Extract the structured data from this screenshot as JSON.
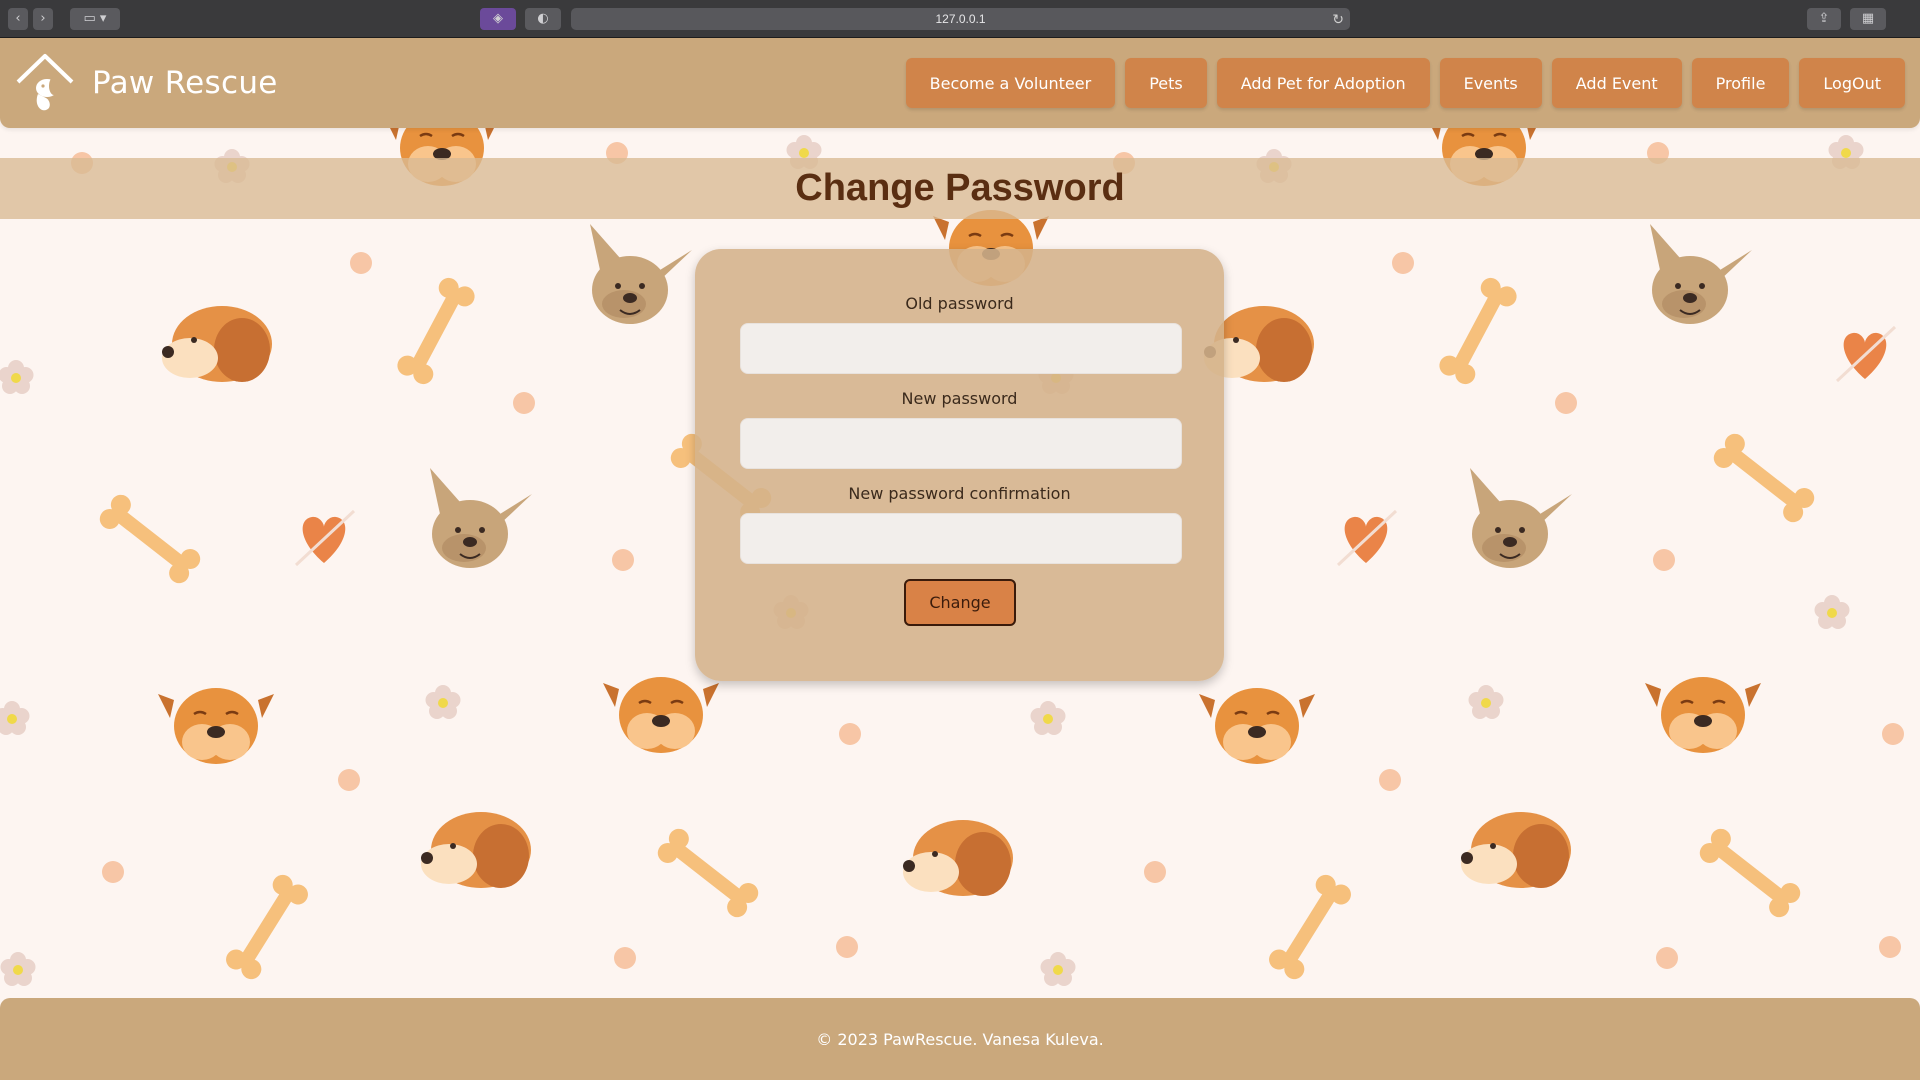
{
  "browser": {
    "address": "127.0.0.1"
  },
  "brand": {
    "name": "Paw Rescue"
  },
  "nav": {
    "items": [
      {
        "label": "Become a Volunteer"
      },
      {
        "label": "Pets"
      },
      {
        "label": "Add Pet for Adoption"
      },
      {
        "label": "Events"
      },
      {
        "label": "Add Event"
      },
      {
        "label": "Profile"
      },
      {
        "label": "LogOut"
      }
    ]
  },
  "page": {
    "title": "Change Password"
  },
  "form": {
    "old_password_label": "Old password",
    "new_password_label": "New password",
    "confirm_password_label": "New password confirmation",
    "old_password_value": "",
    "new_password_value": "",
    "confirm_password_value": "",
    "submit_label": "Change"
  },
  "footer": {
    "text": "© 2023 PawRescue. Vanesa Kuleva."
  },
  "colors": {
    "navbar": "#caa87c",
    "button": "#d0844a",
    "background": "#fdf5f1",
    "title": "#5a2e12",
    "card": "#d4b28a"
  }
}
